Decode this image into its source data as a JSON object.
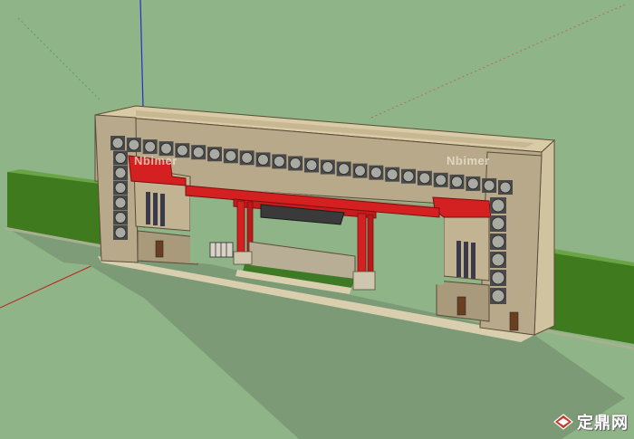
{
  "watermark": {
    "brand": "Nbimer"
  },
  "site_logo": {
    "text": "定鼎网"
  },
  "colors": {
    "ground": "#8fb487",
    "gate_wall": "#b7a98a",
    "gate_top": "#d8cba5",
    "accent_red": "#d42020",
    "hedge": "#3f7a1f",
    "shadow": "#6f8a6a"
  }
}
